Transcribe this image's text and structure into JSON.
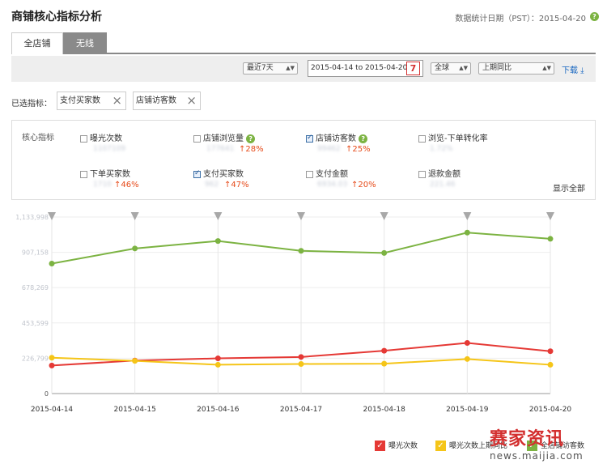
{
  "header": {
    "title": "商铺核心指标分析",
    "stat_date": "数据统计日期（PST）：2015-04-20"
  },
  "tabs": [
    {
      "label": "全店铺",
      "active": false
    },
    {
      "label": "无线",
      "active": true
    }
  ],
  "filters": {
    "period": "最近7天",
    "date_range": "2015-04-14 to 2015-04-20",
    "calendar_day": "7",
    "region": "全球",
    "compare": "上期同比",
    "download": "下载 ⤓"
  },
  "selected": {
    "label": "已选指标：",
    "chips": [
      "支付买家数",
      "店铺访客数"
    ]
  },
  "metrics": {
    "label": "核心指标",
    "items": [
      {
        "name": "曝光次数",
        "checked": false,
        "value": "1107109",
        "delta": "",
        "help": false
      },
      {
        "name": "店铺浏览量",
        "checked": false,
        "value": "177641",
        "delta": "↑28%",
        "help": true
      },
      {
        "name": "店铺访客数",
        "checked": true,
        "value": "99462",
        "delta": "↑25%",
        "help": true
      },
      {
        "name": "浏览-下单转化率",
        "checked": false,
        "value": "1.72%",
        "delta": "",
        "help": false
      },
      {
        "name": "下单买家数",
        "checked": false,
        "value": "1710",
        "delta": "↑46%",
        "help": false
      },
      {
        "name": "支付买家数",
        "checked": true,
        "value": "962",
        "delta": "↑47%",
        "help": false
      },
      {
        "name": "支付金额",
        "checked": false,
        "value": "6934.03",
        "delta": "↑20%",
        "help": false
      },
      {
        "name": "退款金额",
        "checked": false,
        "value": "221.46",
        "delta": "",
        "help": false
      }
    ],
    "show_all": "显示全部"
  },
  "chart_data": {
    "type": "line",
    "categories": [
      "2015-04-14",
      "2015-04-15",
      "2015-04-16",
      "2015-04-17",
      "2015-04-18",
      "2015-04-19",
      "2015-04-20"
    ],
    "y_ticks": [
      "1,133,998",
      "907,158",
      "678,269",
      "453,599",
      "226,799",
      "0"
    ],
    "ylim": [
      0,
      1133998
    ],
    "series": [
      {
        "name": "曝光次数",
        "color": "#e53935",
        "values": [
          180000,
          212000,
          226000,
          235000,
          275000,
          325000,
          272000
        ]
      },
      {
        "name": "曝光次数上期同比",
        "color": "#f5c518",
        "values": [
          230000,
          210000,
          185000,
          190000,
          192000,
          222000,
          185000
        ]
      },
      {
        "name": "全店铺访客数",
        "color": "#7cb342",
        "values": [
          835000,
          932000,
          980000,
          917000,
          903000,
          1034000,
          994000
        ]
      }
    ],
    "legend": [
      "曝光次数",
      "曝光次数上期同比",
      "全店铺访客数"
    ]
  },
  "watermark": {
    "title": "赛家资讯",
    "url": "news.maijia.com"
  }
}
